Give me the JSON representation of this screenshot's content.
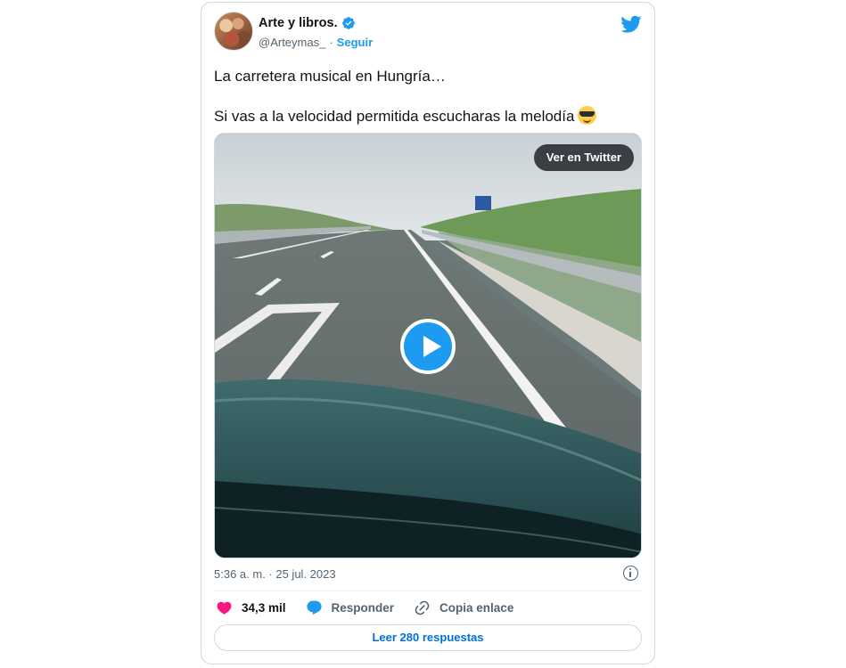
{
  "author": {
    "name": "Arte y libros.",
    "handle": "@Arteymas_",
    "separator": "·",
    "follow_label": "Seguir"
  },
  "tweet": {
    "line1": "La carretera musical en Hungría…",
    "line2": "Si vas a la velocidad permitida escucharas la melodía",
    "emoji": "smiling-face-with-sunglasses"
  },
  "media": {
    "view_label": "Ver en Twitter"
  },
  "meta": {
    "timestamp": "5:36 a. m. · 25 jul. 2023"
  },
  "actions": {
    "likes": "34,3 mil",
    "reply_label": "Responder",
    "copy_label": "Copia enlace"
  },
  "replies": {
    "label": "Leer 280 respuestas"
  },
  "colors": {
    "accent": "#1d9bf0",
    "like": "#f91880",
    "link": "#006fd6"
  }
}
